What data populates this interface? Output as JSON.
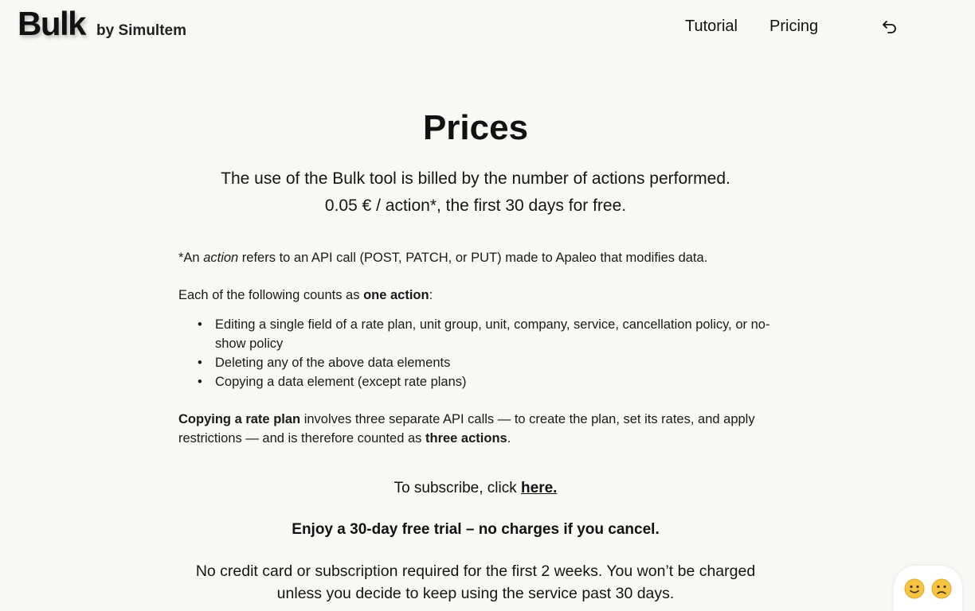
{
  "header": {
    "brand": "Bulk",
    "brand_by": "by Simultem",
    "nav": [
      {
        "label": "Tutorial"
      },
      {
        "label": "Pricing"
      }
    ],
    "back_icon": "undo-arrow-icon"
  },
  "main": {
    "title": "Prices",
    "intro_line1": "The use of the Bulk tool is billed by the number of actions performed.",
    "intro_line2": "0.05 € / action*, the first 30 days for free.",
    "footnote_prefix": "*An ",
    "footnote_term": "action",
    "footnote_rest": " refers to an API call (POST, PATCH, or PUT) made to Apaleo that modifies data.",
    "counts_prefix": "Each of the following counts as ",
    "counts_bold": "one action",
    "counts_suffix": ":",
    "actions": [
      "Editing a single field of a rate plan, unit group, unit, company, service, cancellation policy, or no-show policy",
      "Deleting any of the above data elements",
      "Copying a data element (except rate plans)"
    ],
    "copy_bold": "Copying a rate plan",
    "copy_rest": " involves three separate API calls — to create the plan, set its rates, and apply restrictions — and is therefore counted as ",
    "copy_bold2": "three actions",
    "copy_end": ".",
    "subscribe_prefix": "To subscribe, click ",
    "subscribe_link": "here.",
    "trial": "Enjoy a 30-day free trial – no charges if you cancel.",
    "nocard_line1": "No credit card or subscription required for the first 2 weeks. You won’t be charged",
    "nocard_line2": "unless you decide to keep using the service past 30 days."
  },
  "feedback": {
    "positive_icon": "happy-face-icon",
    "negative_icon": "sad-face-icon",
    "face_color": "#f5c542"
  }
}
